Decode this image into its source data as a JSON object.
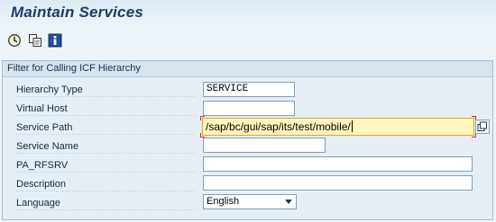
{
  "window": {
    "title": "Maintain Services"
  },
  "toolbar": {
    "items": [
      {
        "icon": "execute-icon"
      },
      {
        "icon": "copy-icon"
      },
      {
        "icon": "information-icon"
      }
    ]
  },
  "filter_group": {
    "title": "Filter for Calling ICF Hierarchy",
    "fields": [
      {
        "label": "Hierarchy Type",
        "value": "SERVICE"
      },
      {
        "label": "Virtual Host",
        "value": ""
      },
      {
        "label": "Service Path",
        "value": "/sap/bc/gui/sap/its/test/mobile/"
      },
      {
        "label": "Service Name",
        "value": ""
      },
      {
        "label": "PA_RFSRV",
        "value": ""
      },
      {
        "label": "Description",
        "value": ""
      },
      {
        "label": "Language",
        "value": "English"
      }
    ]
  },
  "colors": {
    "title_text": "#1b3c67",
    "background": "#eef5fa",
    "focused_field_bg": "#fff7bf",
    "focus_corner": "#d9262b"
  }
}
